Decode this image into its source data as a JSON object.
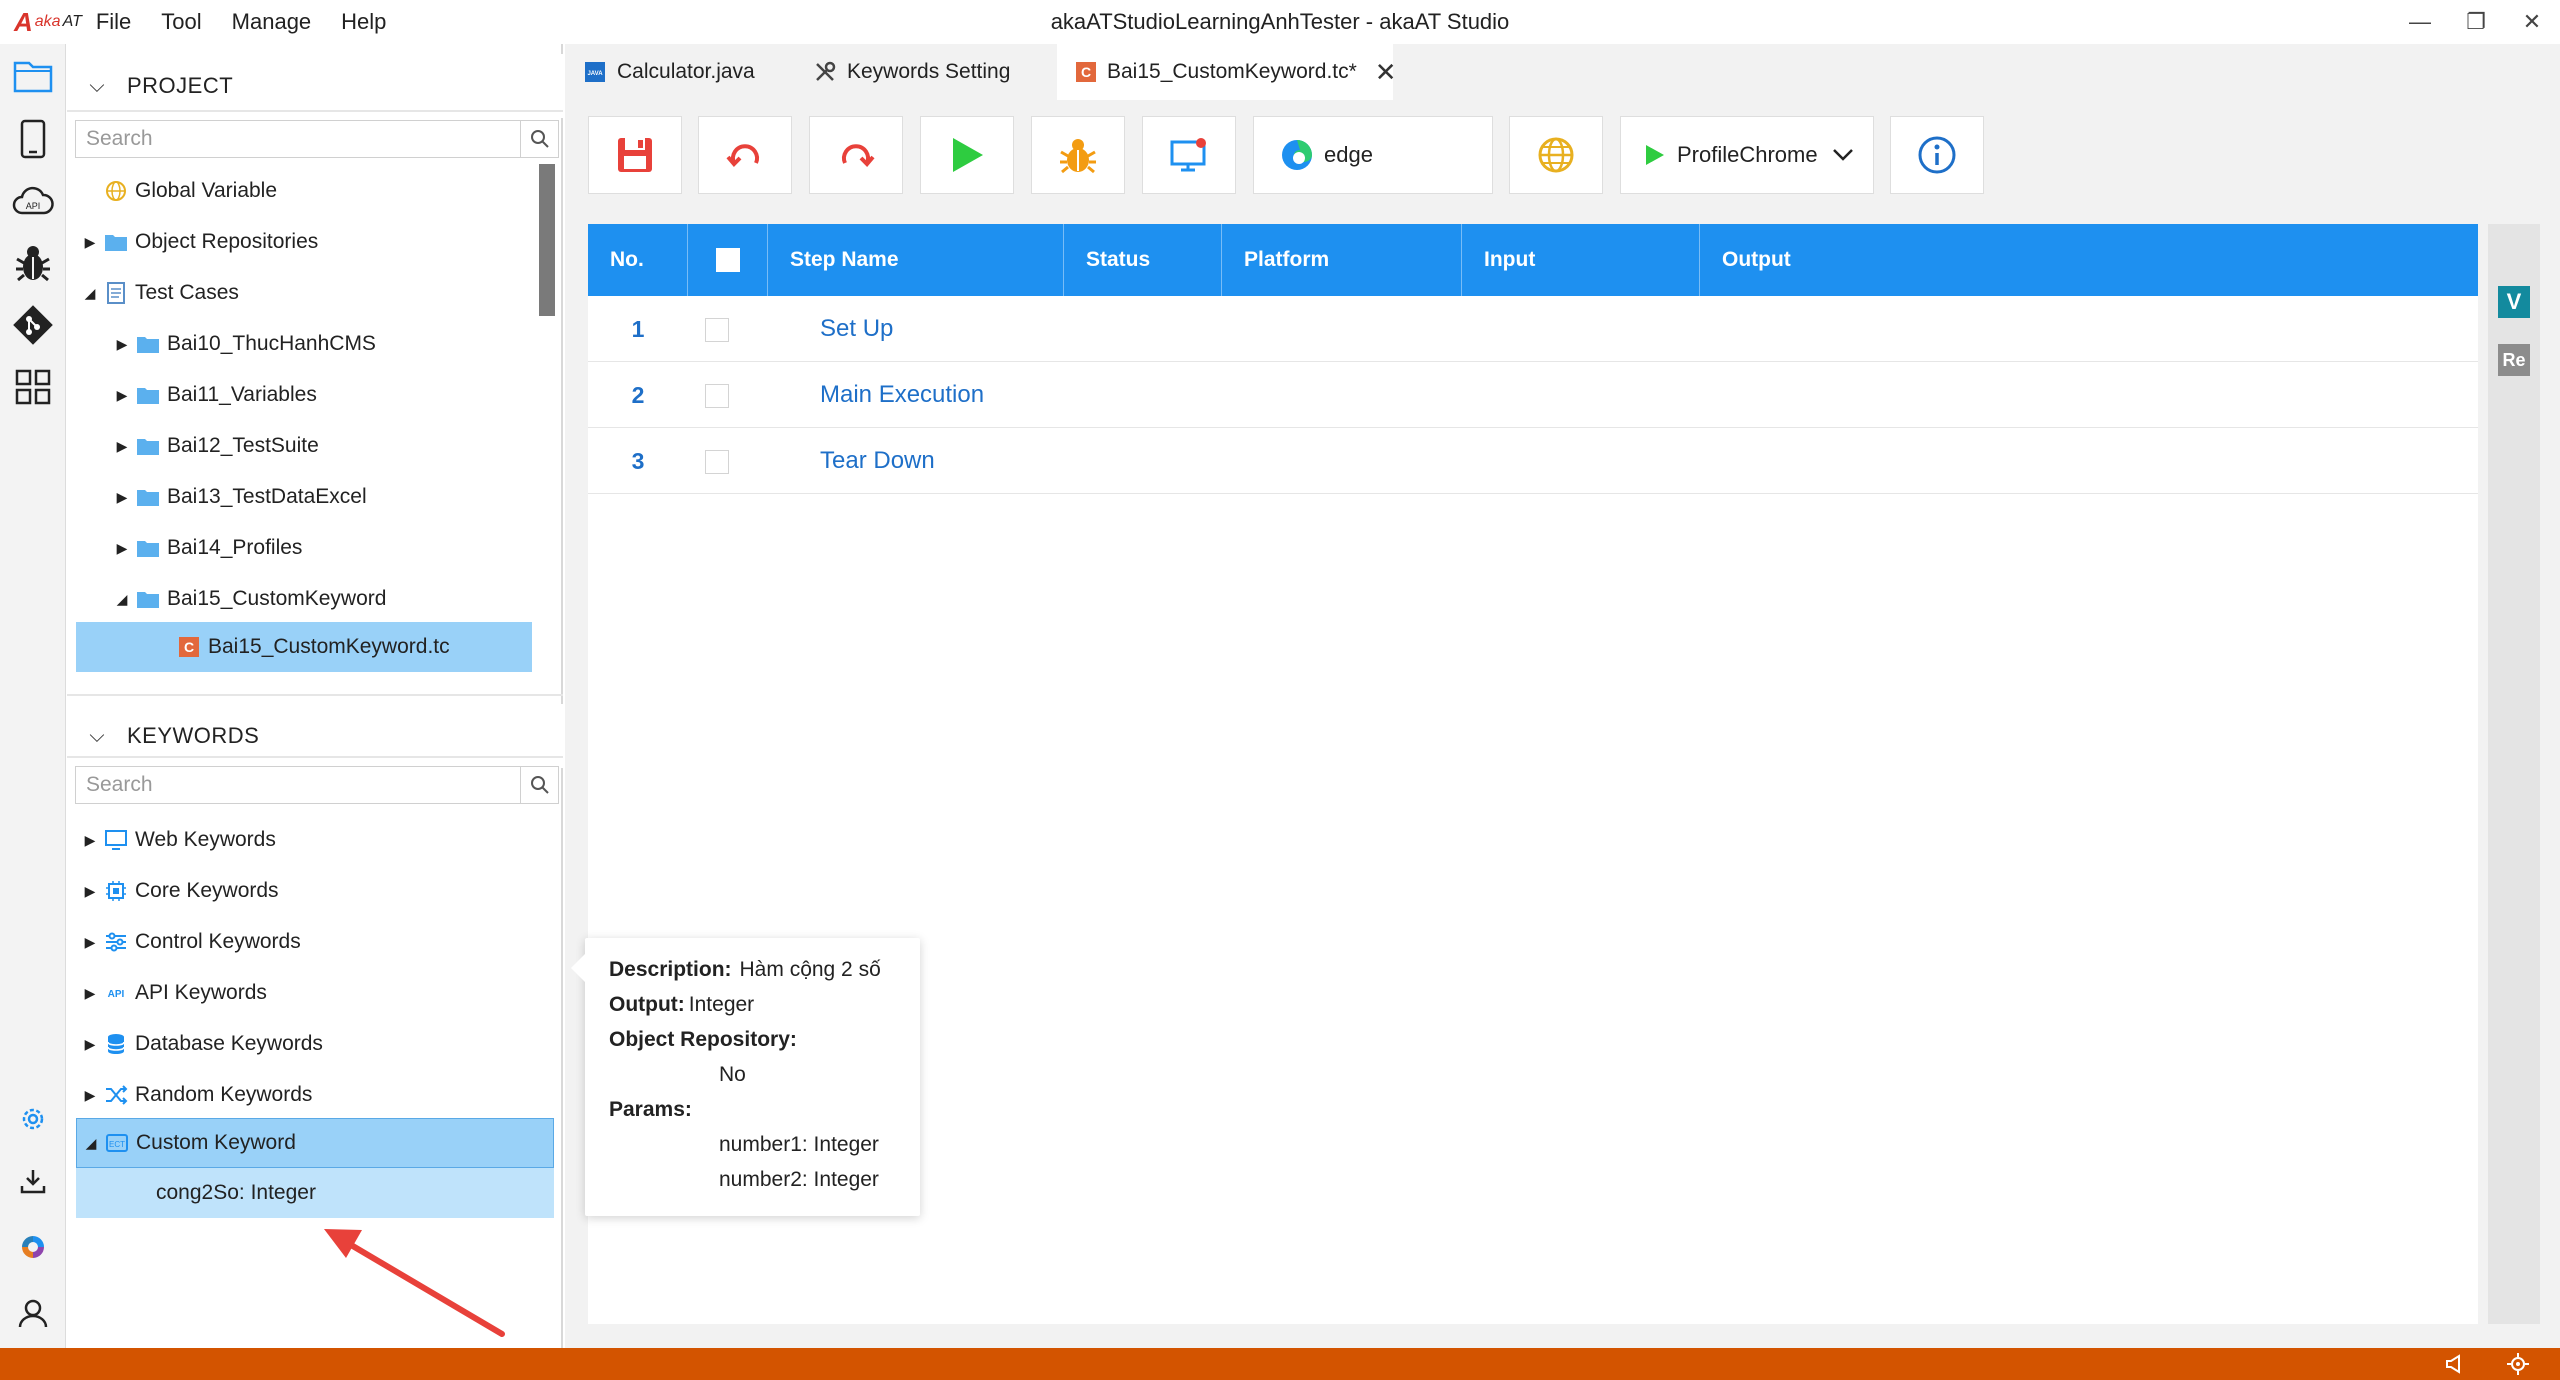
{
  "app": {
    "title": "akaATStudioLearningAnhTester - akaAT Studio",
    "logo_a": "A",
    "logo_aka": "aka",
    "logo_at": "AT"
  },
  "menu": [
    "File",
    "Tool",
    "Manage",
    "Help"
  ],
  "project": {
    "title": "PROJECT",
    "search_placeholder": "Search",
    "items": [
      {
        "label": "Global Variable",
        "icon": "globe-icon"
      },
      {
        "label": "Object Repositories",
        "icon": "folder-icon"
      },
      {
        "label": "Test Cases",
        "icon": "document-icon"
      },
      {
        "label": "Bai10_ThucHanhCMS",
        "icon": "folder-icon"
      },
      {
        "label": "Bai11_Variables",
        "icon": "folder-icon"
      },
      {
        "label": "Bai12_TestSuite",
        "icon": "folder-icon"
      },
      {
        "label": "Bai13_TestDataExcel",
        "icon": "folder-icon"
      },
      {
        "label": "Bai14_Profiles",
        "icon": "folder-icon"
      },
      {
        "label": "Bai15_CustomKeyword",
        "icon": "folder-icon"
      },
      {
        "label": "Bai15_CustomKeyword.tc",
        "icon": "testcase-file-icon"
      }
    ]
  },
  "keywords": {
    "title": "KEYWORDS",
    "search_placeholder": "Search",
    "items": [
      {
        "label": "Web Keywords",
        "icon": "monitor-icon"
      },
      {
        "label": "Core Keywords",
        "icon": "chip-icon"
      },
      {
        "label": "Control Keywords",
        "icon": "sliders-icon"
      },
      {
        "label": "API Keywords",
        "icon": "api-icon"
      },
      {
        "label": "Database Keywords",
        "icon": "database-icon"
      },
      {
        "label": "Random Keywords",
        "icon": "shuffle-icon"
      },
      {
        "label": "Custom Keyword",
        "icon": "custom-keyword-icon"
      }
    ],
    "custom_child": "cong2So: Integer"
  },
  "tabs": [
    {
      "label": "Calculator.java",
      "icon": "java-file-icon"
    },
    {
      "label": "Keywords Setting",
      "icon": "tools-icon"
    },
    {
      "label": "Bai15_CustomKeyword.tc*",
      "icon": "testcase-file-icon"
    }
  ],
  "toolbar": {
    "browser_label": "edge",
    "profile_label": "ProfileChrome"
  },
  "grid": {
    "columns": [
      "No.",
      "",
      "Step Name",
      "Status",
      "Platform",
      "Input",
      "Output"
    ],
    "rows": [
      {
        "no": "1",
        "name": "Set Up"
      },
      {
        "no": "2",
        "name": "Main Execution"
      },
      {
        "no": "3",
        "name": "Tear Down"
      }
    ]
  },
  "side_badges": {
    "v": "V",
    "re": "Re"
  },
  "tooltip": {
    "description_label": "Description:",
    "description_value": "Hàm cộng 2 số",
    "output_label": "Output:",
    "output_value": "Integer",
    "repo_label": "Object Repository:",
    "repo_value": "No",
    "params_label": "Params:",
    "params": [
      "number1: Integer",
      "number2: Integer"
    ]
  },
  "colors": {
    "accent": "#1e90f0",
    "status_bar": "#d35400",
    "selection": "#99d1f8",
    "annotation_arrow": "#e8413a"
  }
}
